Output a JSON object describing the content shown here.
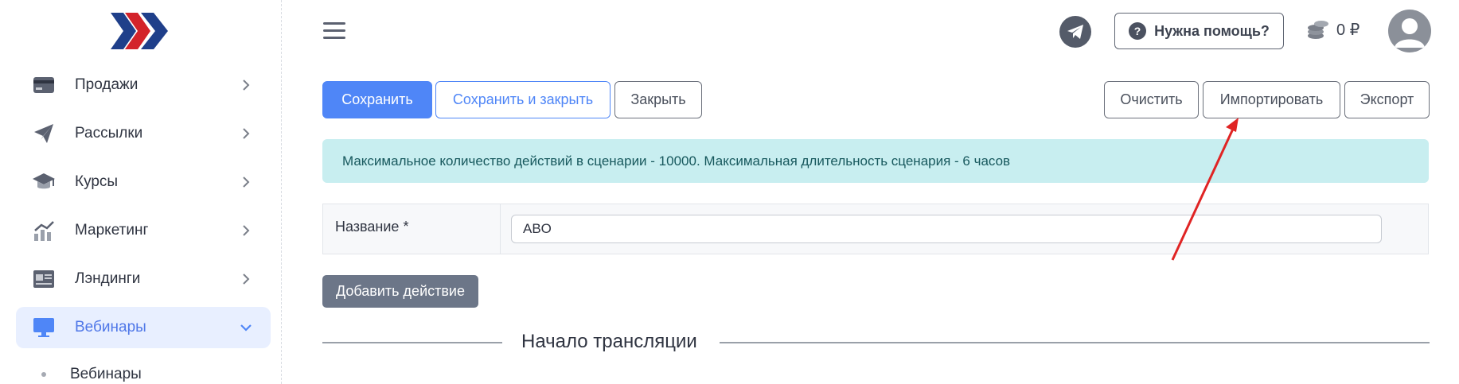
{
  "sidebar": {
    "items": [
      {
        "label": "Продажи",
        "icon": "card-icon"
      },
      {
        "label": "Рассылки",
        "icon": "paper-plane-icon"
      },
      {
        "label": "Курсы",
        "icon": "graduation-cap-icon"
      },
      {
        "label": "Маркетинг",
        "icon": "chart-icon"
      },
      {
        "label": "Лэндинги",
        "icon": "landing-icon"
      },
      {
        "label": "Вебинары",
        "icon": "monitor-icon",
        "active": true
      }
    ],
    "sub_items": [
      {
        "label": "Вебинары"
      }
    ]
  },
  "header": {
    "help_label": "Нужна помощь?",
    "help_icon_text": "?",
    "balance": "0 ₽"
  },
  "toolbar": {
    "save": "Сохранить",
    "save_close": "Сохранить и закрыть",
    "close": "Закрыть",
    "clear": "Очистить",
    "import": "Импортировать",
    "export": "Экспорт"
  },
  "alert": {
    "text": "Максимальное количество действий в сценарии - 10000. Максимальная длительность сценария - 6 часов"
  },
  "form": {
    "name_label": "Название *",
    "name_value": "ABO"
  },
  "actions": {
    "add_action": "Добавить действие"
  },
  "section": {
    "title": "Начало трансляции"
  },
  "colors": {
    "primary": "#4f86f7",
    "sidebar_active_bg": "#e8efff",
    "alert_bg": "#c8eef0",
    "annotation_arrow": "#e02424"
  }
}
